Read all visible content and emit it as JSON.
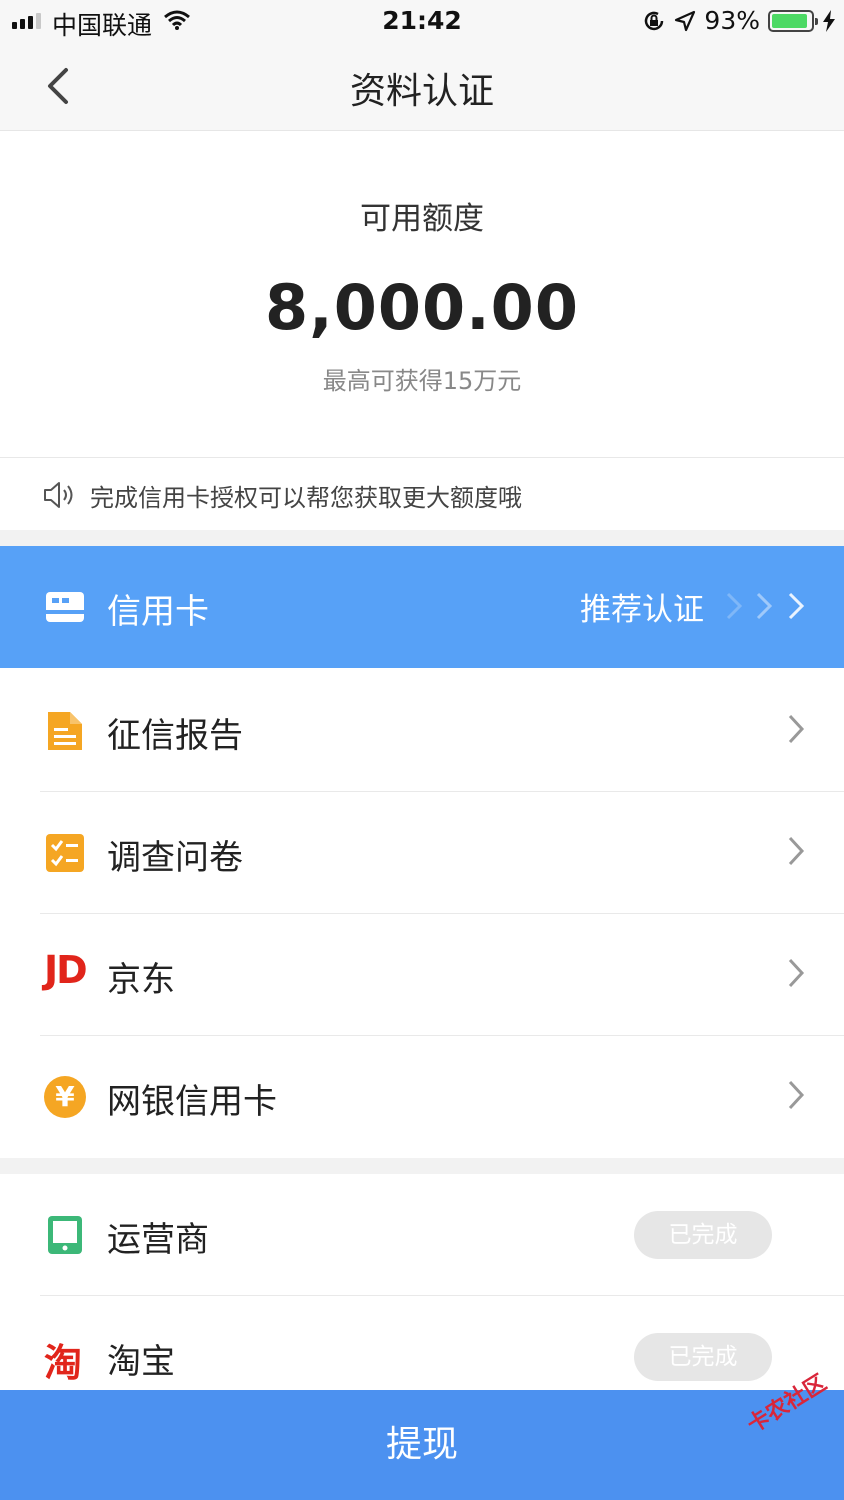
{
  "status_bar": {
    "carrier": "中国联通",
    "time": "21:42",
    "battery": "93%",
    "battery_level": 0.93
  },
  "nav": {
    "title": "资料认证",
    "back_icon": "chevron-left-icon"
  },
  "credit": {
    "label": "可用额度",
    "amount": "8,000.00",
    "max_text": "最高可获得15万元"
  },
  "notice": {
    "icon": "speaker-icon",
    "text": "完成信用卡授权可以帮您获取更大额度哦"
  },
  "items": [
    {
      "label": "信用卡",
      "icon": "credit-card-icon",
      "action": "推荐认证",
      "highlighted": true
    },
    {
      "label": "征信报告",
      "icon": "document-icon"
    },
    {
      "label": "调查问卷",
      "icon": "checklist-icon"
    },
    {
      "label": "京东",
      "icon": "jd-logo-icon",
      "logo_text": "JD"
    },
    {
      "label": "网银信用卡",
      "icon": "yuan-coin-icon",
      "logo_text": "¥"
    }
  ],
  "completed_items": [
    {
      "label": "运营商",
      "icon": "phone-icon",
      "status": "已完成"
    },
    {
      "label": "淘宝",
      "icon": "taobao-logo-icon",
      "logo_text": "淘",
      "status": "已完成"
    }
  ],
  "footer": {
    "button": "提现"
  },
  "watermark": "卡农社区",
  "colors": {
    "highlight": "#57a1f7",
    "button": "#4c91f0",
    "orange": "#f5a623",
    "jd_red": "#e1251b",
    "green": "#3cb878"
  }
}
